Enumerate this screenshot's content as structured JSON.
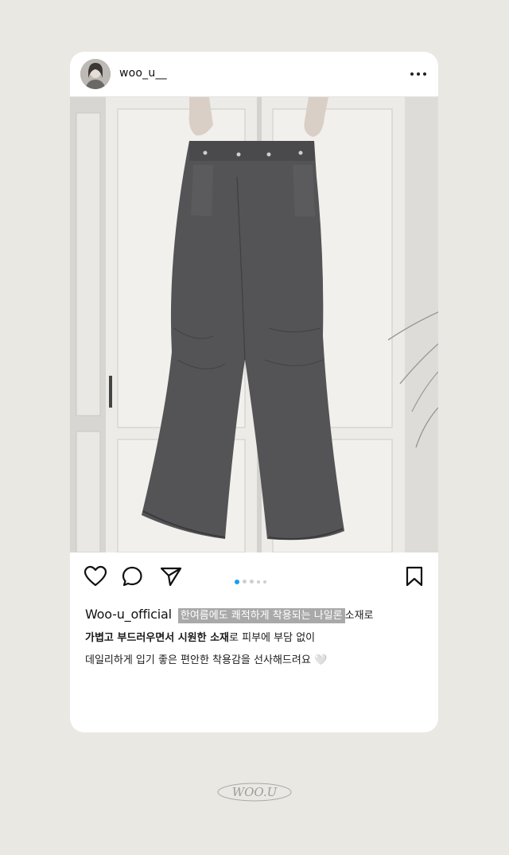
{
  "post": {
    "username": "woo_u__",
    "more_icon": "more-horizontal-icon",
    "photo_alt": "",
    "carousel": {
      "count": 5,
      "active": 1
    }
  },
  "actions": {
    "like_icon": "heart-icon",
    "comment_icon": "comment-icon",
    "share_icon": "send-icon",
    "save_icon": "bookmark-icon"
  },
  "caption": {
    "brand": "Woo-u_official",
    "line1_highlight": "한여름에도 쾌적하게 착용되는 나일론",
    "line1_rest": "소재로",
    "line2_bold": "가볍고 부드러우면서 시원한 소재",
    "line2_rest": "로 피부에 부담 없이",
    "line3": "데일리하게 입기 좋은 편안한 착용감을 선사해드려요",
    "line3_emoji": "🤍"
  },
  "footer": {
    "logo_text": "WOO.U"
  },
  "colors": {
    "background": "#e9e8e3",
    "card": "#ffffff",
    "highlight": "#a9a9a9",
    "dot_active": "#1e9bf0",
    "dot_inactive": "#cfcfcf"
  }
}
